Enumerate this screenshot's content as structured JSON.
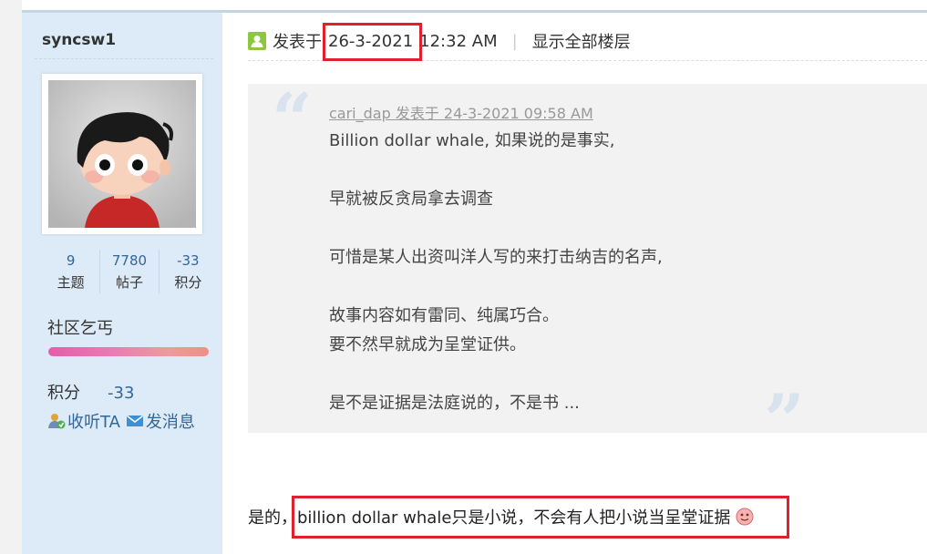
{
  "sidebar": {
    "username": "syncsw1",
    "stats": [
      {
        "value": "9",
        "label": "主题"
      },
      {
        "value": "7780",
        "label": "帖子"
      },
      {
        "value": "-33",
        "label": "积分"
      }
    ],
    "rank_title": "社区乞丐",
    "score_label": "积分",
    "score_value": "-33",
    "follow_label": "收听TA",
    "message_label": "发消息"
  },
  "post": {
    "posted_prefix": "发表于",
    "date": "26-3-2021",
    "time": "12:32 AM",
    "separator": "|",
    "show_all_floors": "显示全部楼层",
    "quote": {
      "author": "cari_dap",
      "meta_text": "cari_dap 发表于 24-3-2021 09:58 AM",
      "lines": [
        "Billion dollar whale, 如果说的是事实,",
        "",
        "早就被反贪局拿去调查",
        "",
        "可惜是某人出资叫洋人写的来打击纳吉的名声,",
        "",
        "故事内容如有雷同、纯属巧合。",
        "要不然早就成为呈堂证供。",
        "",
        "是不是证据是法庭说的，不是书 ..."
      ]
    },
    "reply_prefix": "是的，",
    "reply_highlighted": "billion dollar whale只是小说，不会有人把小说当呈堂证据"
  },
  "icons": {
    "user": "user-icon",
    "follow": "follow-icon",
    "message": "envelope-icon",
    "smiley": "smiley-icon"
  },
  "colors": {
    "sidebar_bg": "#ddeaf7",
    "link": "#336699",
    "quote_bg": "#f2f2f2",
    "highlight": "#e2202d"
  }
}
